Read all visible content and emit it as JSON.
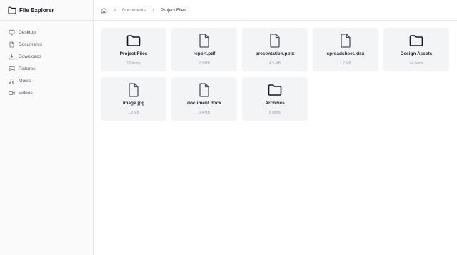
{
  "app": {
    "title": "File Explorer"
  },
  "sidebar": {
    "items": [
      {
        "label": "Desktop",
        "icon": "monitor-icon"
      },
      {
        "label": "Documents",
        "icon": "document-icon"
      },
      {
        "label": "Downloads",
        "icon": "download-icon"
      },
      {
        "label": "Pictures",
        "icon": "image-icon"
      },
      {
        "label": "Music",
        "icon": "music-icon"
      },
      {
        "label": "Videos",
        "icon": "video-icon"
      }
    ]
  },
  "breadcrumb": {
    "home_icon": "home-icon",
    "items": [
      "Documents",
      "Project Files"
    ]
  },
  "files": [
    {
      "name": "Project Files",
      "meta": "12 items",
      "kind": "folder"
    },
    {
      "name": "report.pdf",
      "meta": "2.3 MB",
      "kind": "file"
    },
    {
      "name": "presentation.pptx",
      "meta": "4.5 MB",
      "kind": "file"
    },
    {
      "name": "spreadsheet.xlsx",
      "meta": "1.7 MB",
      "kind": "file"
    },
    {
      "name": "Design Assets",
      "meta": "24 items",
      "kind": "folder"
    },
    {
      "name": "image.jpg",
      "meta": "1.2 MB",
      "kind": "file"
    },
    {
      "name": "document.docx",
      "meta": "3.4 MB",
      "kind": "file"
    },
    {
      "name": "Archives",
      "meta": "8 items",
      "kind": "folder"
    }
  ]
}
